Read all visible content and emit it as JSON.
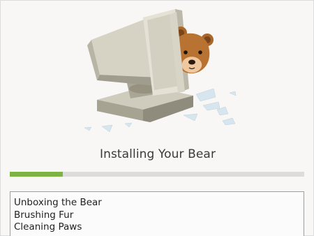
{
  "installer": {
    "status_title": "Installing Your Bear",
    "progress": 0.18,
    "colors": {
      "progress_fill": "#7cb342",
      "progress_track": "#dcdcdc",
      "background": "#f8f7f5"
    },
    "illustration": "bear-peeking-from-computer-monitor",
    "log_lines": [
      "Unboxing the Bear",
      "Brushing Fur",
      "Cleaning Paws"
    ]
  }
}
